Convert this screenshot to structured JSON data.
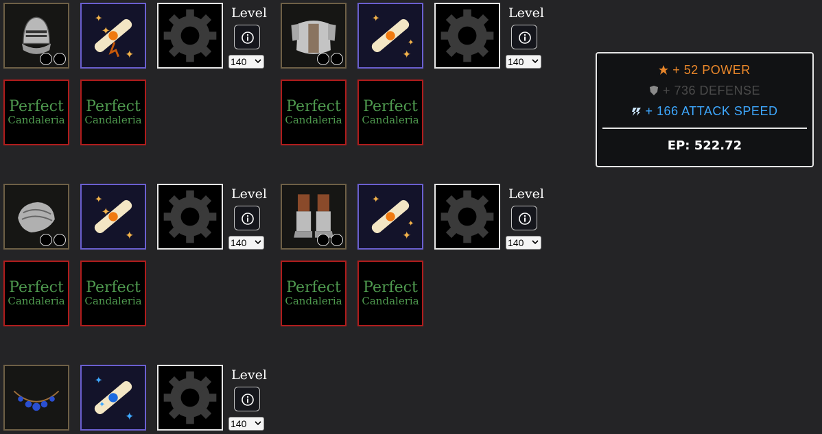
{
  "level_label": "Level",
  "level_value": "140",
  "perfect_big": "Perfect",
  "perfect_small": "Candaleria",
  "stats": {
    "power": "+ 52 POWER",
    "defense": "+ 736 DEFENSE",
    "attack_speed": "+ 166 ATTACK SPEED",
    "ep": "EP: 522.72"
  },
  "colors": {
    "power": "#e8862a",
    "defense": "#4a4a4a",
    "attack_speed": "#3ea8ff",
    "perfect_text": "#4f9a4f",
    "perfect_border": "#b01c1c",
    "scroll_border": "#6a5fd0"
  },
  "items": [
    {
      "slot": "helmet",
      "icon": "helmet-icon"
    },
    {
      "slot": "chest",
      "icon": "chest-armor-icon"
    },
    {
      "slot": "gloves",
      "icon": "gloves-icon"
    },
    {
      "slot": "boots",
      "icon": "boots-icon"
    },
    {
      "slot": "necklace",
      "icon": "necklace-icon"
    }
  ]
}
